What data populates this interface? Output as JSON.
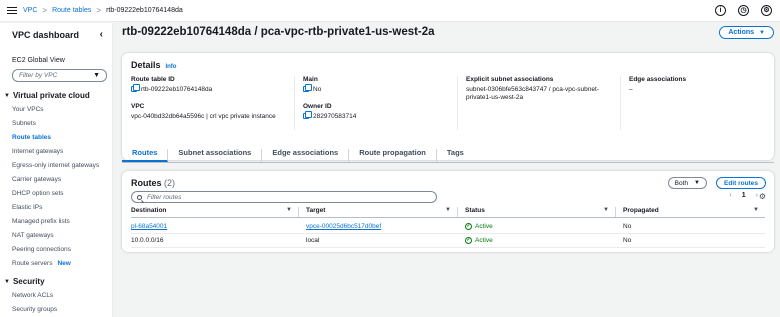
{
  "topbar": {
    "breadcrumbs": [
      "VPC",
      "Route tables",
      "rtb-09222eb10764148da"
    ],
    "separator": ">"
  },
  "sidebar": {
    "title": "VPC dashboard",
    "ec2_link": "EC2 Global View",
    "filter_placeholder": "Filter by VPC",
    "sections": [
      {
        "label": "Virtual private cloud",
        "items": [
          {
            "label": "Your VPCs"
          },
          {
            "label": "Subnets"
          },
          {
            "label": "Route tables",
            "active": true
          },
          {
            "label": "Internet gateways"
          },
          {
            "label": "Egress-only internet gateways"
          },
          {
            "label": "Carrier gateways"
          },
          {
            "label": "DHCP option sets"
          },
          {
            "label": "Elastic IPs"
          },
          {
            "label": "Managed prefix lists"
          },
          {
            "label": "NAT gateways"
          },
          {
            "label": "Peering connections"
          },
          {
            "label": "Route servers",
            "badge": "New"
          }
        ]
      },
      {
        "label": "Security",
        "items": [
          {
            "label": "Network ACLs"
          },
          {
            "label": "Security groups"
          }
        ]
      }
    ]
  },
  "page": {
    "title": "rtb-09222eb10764148da / pca-vpc-rtb-private1-us-west-2a",
    "actions_label": "Actions"
  },
  "details": {
    "title": "Details",
    "info": "Info",
    "route_table_id_label": "Route table ID",
    "route_table_id": "rtb-09222eb10764148da",
    "vpc_label": "VPC",
    "vpc_value": "vpc-040bd32db64a5596c | crl vpc private instance",
    "main_label": "Main",
    "main_value": "No",
    "owner_label": "Owner ID",
    "owner_value": "282970583714",
    "explicit_label": "Explicit subnet associations",
    "explicit_value": "subnet-0306bfe563c843747 / pca-vpc-subnet-private1-us-west-2a",
    "edge_label": "Edge associations",
    "edge_value": "–"
  },
  "tabs": [
    "Routes",
    "Subnet associations",
    "Edge associations",
    "Route propagation",
    "Tags"
  ],
  "routes": {
    "title": "Routes",
    "count": "(2)",
    "both_label": "Both",
    "edit_label": "Edit routes",
    "filter_placeholder": "Filter routes",
    "page": "1",
    "columns": [
      "Destination",
      "Target",
      "Status",
      "Propagated"
    ],
    "rows": [
      {
        "destination": "pl-68a54001",
        "target": "vpce-00025d6bc517d0bef",
        "status": "Active",
        "propagated": "No"
      },
      {
        "destination": "10.0.0.0/16",
        "target": "local",
        "status": "Active",
        "propagated": "No"
      }
    ]
  },
  "colors": {
    "link": "#0972d3",
    "success": "#037f0c",
    "text": "#16191f"
  }
}
